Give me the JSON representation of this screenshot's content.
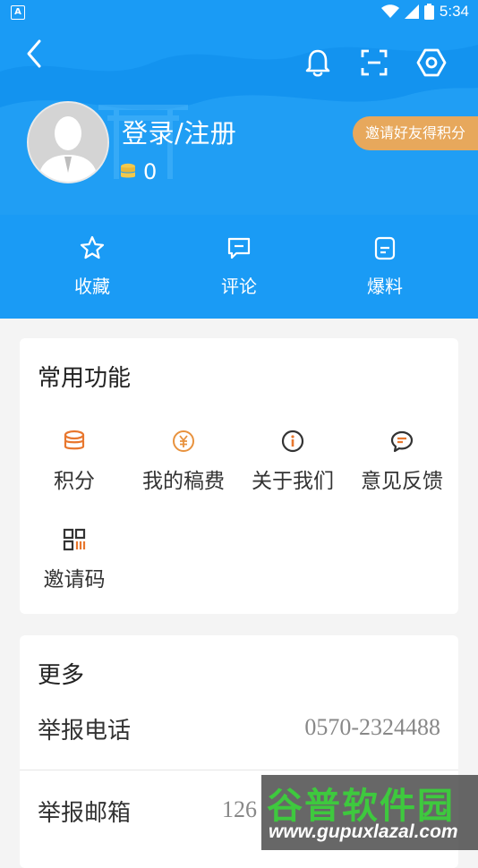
{
  "status_bar": {
    "time": "5:34",
    "app_badge": "A"
  },
  "header": {
    "login_label": "登录/注册",
    "points_value": "0",
    "invite_label": "邀请好友得积分",
    "quick_actions": [
      {
        "label": "收藏",
        "icon": "star-icon"
      },
      {
        "label": "评论",
        "icon": "comment-icon"
      },
      {
        "label": "爆料",
        "icon": "tipoff-icon"
      }
    ]
  },
  "common": {
    "title": "常用功能",
    "items": [
      {
        "label": "积分",
        "icon": "coins-icon"
      },
      {
        "label": "我的稿费",
        "icon": "yuan-icon"
      },
      {
        "label": "关于我们",
        "icon": "info-icon"
      },
      {
        "label": "意见反馈",
        "icon": "feedback-icon"
      },
      {
        "label": "邀请码",
        "icon": "qr-code-icon"
      }
    ]
  },
  "more": {
    "title": "更多",
    "rows": [
      {
        "label": "举报电话",
        "value": "0570-2324488"
      },
      {
        "label": "举报邮箱",
        "value": "126"
      }
    ]
  },
  "watermark": {
    "title": "谷普软件园",
    "url": "www.gupuxlazal.com"
  },
  "colors": {
    "header": "#1a9bf5",
    "accent_orange": "#e8772e",
    "invite_pill": "#e7a85c",
    "coin": "#f2c94c"
  }
}
